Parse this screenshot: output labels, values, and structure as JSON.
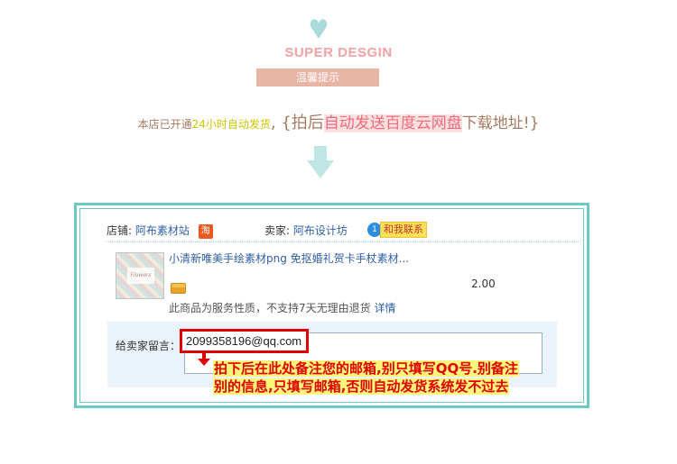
{
  "header": {
    "brand": "SUPER DESGIN",
    "tip_label": "温馨提示",
    "icon": "heart-icon"
  },
  "notice": {
    "part1": "本店已开通",
    "part2": "24小时自动发货",
    "part3": ", {拍后",
    "part4": "自动发送百度云网盘",
    "part5": "下载地址!}"
  },
  "order": {
    "shop_label": "店铺:",
    "shop_name": "阿布素材站",
    "shop_badge": "淘",
    "seller_label": "卖家:",
    "seller_name": "阿布设计坊",
    "contact_badge": "1",
    "contact_label": "和我联系",
    "item_title": "小清新唯美手绘素材png 免抠婚礼贺卡手杖素材...",
    "thumb_text": "Flowers",
    "price": "2.00",
    "service_text": "此商品为服务性质，不支持7天无理由退货",
    "service_link": "详情",
    "message_label": "给卖家留言：",
    "message_value": "2099358196@qq.com"
  },
  "warning": {
    "line1": "拍下后在此处备注您的邮箱,别只填写QQ号.别备注",
    "line2": "别的信息,只填写邮箱,否则自动发货系统发不过去"
  },
  "colors": {
    "frame": "#6cc9c3",
    "tip_bar": "#e8b5a4",
    "highlight_red": "#e00000",
    "highlight_yellow": "#fff67a",
    "link_blue": "#2f5fa6"
  }
}
